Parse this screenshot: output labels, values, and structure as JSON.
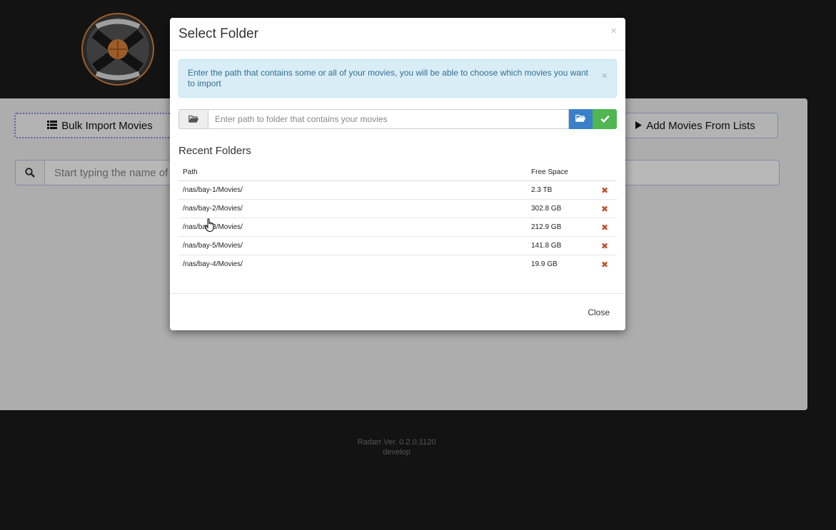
{
  "background": {
    "bulk_import_label": "Bulk Import Movies",
    "add_from_lists_label": "Add Movies From Lists",
    "search_placeholder": "Start typing the name of",
    "footer_version": "Radarr Ver. 0.2.0.1120",
    "footer_branch": "develop"
  },
  "modal": {
    "title": "Select Folder",
    "close_x": "×",
    "info_text": "Enter the path that contains some or all of your movies, you will be able to choose which movies you want to import",
    "path_placeholder": "Enter path to folder that contains your movies",
    "path_value": "",
    "recent_title": "Recent Folders",
    "columns": {
      "path": "Path",
      "free_space": "Free Space"
    },
    "folders": [
      {
        "path": "/nas/bay-1/Movies/",
        "free": "2.3 TB"
      },
      {
        "path": "/nas/bay-2/Movies/",
        "free": "302.8 GB"
      },
      {
        "path": "/nas/bay-3/Movies/",
        "free": "212.9 GB"
      },
      {
        "path": "/nas/bay-5/Movies/",
        "free": "141.8 GB"
      },
      {
        "path": "/nas/bay-4/Movies/",
        "free": "19.9 GB"
      }
    ],
    "remove_glyph": "✖",
    "close_label": "Close"
  },
  "icons": {
    "logo": "radarr-logo",
    "list": "list-icon",
    "play": "play-icon",
    "search": "search-icon",
    "folder": "folder-open-icon",
    "check": "check-icon",
    "remove": "remove-icon"
  },
  "colors": {
    "accent_orange": "#d9823a",
    "info_bg": "#d9edf7",
    "primary_blue": "#3a80c9",
    "success_green": "#4fb651",
    "danger": "#c0532f"
  }
}
